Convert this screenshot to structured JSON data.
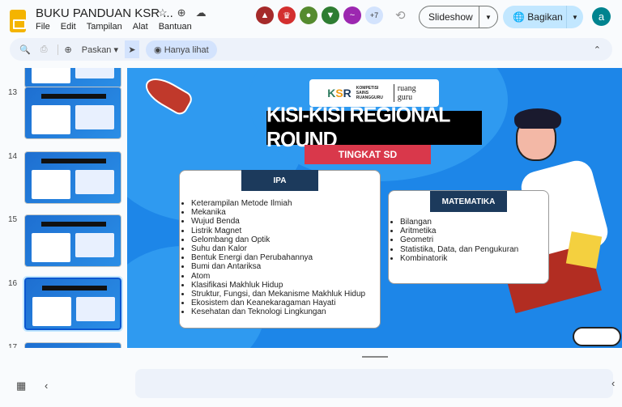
{
  "header": {
    "title": "BUKU PANDUAN KSR ...",
    "menu": [
      "File",
      "Edit",
      "Tampilan",
      "Alat",
      "Bantuan"
    ],
    "more_collaborators": "+7",
    "slideshow": "Slideshow",
    "share": "Bagikan",
    "user_initial": "a"
  },
  "collaborator_colors": [
    "#a52a2a",
    "#d32f2f",
    "#558b2f",
    "#2e7d32",
    "#9c27b0"
  ],
  "toolbar": {
    "zoom": "Paskan",
    "mode": "Hanya lihat"
  },
  "thumbnails": [
    {
      "num": "13"
    },
    {
      "num": "14"
    },
    {
      "num": "15"
    },
    {
      "num": "16",
      "selected": true
    },
    {
      "num": "17"
    }
  ],
  "slide": {
    "logo_text": "KOMPETISI SAINS RUANGGURU",
    "logo_brand": "ruang guru",
    "title": "KISI-KISI REGIONAL ROUND",
    "subtitle": "TINGKAT SD",
    "ipa": {
      "heading": "IPA",
      "items": [
        "Keterampilan Metode Ilmiah",
        "Mekanika",
        "Wujud Benda",
        "Listrik Magnet",
        "Gelombang dan Optik",
        "Suhu dan Kalor",
        "Bentuk Energi dan Perubahannya",
        "Bumi dan Antariksa",
        "Atom",
        "Klasifikasi Makhluk Hidup",
        "Struktur, Fungsi, dan Mekanisme Makhluk Hidup",
        "Ekosistem dan Keanekaragaman Hayati",
        "Kesehatan dan Teknologi Lingkungan"
      ]
    },
    "mat": {
      "heading": "MATEMATIKA",
      "items": [
        "Bilangan",
        "Aritmetika",
        "Geometri",
        "Statistika, Data, dan Pengukuran",
        "Kombinatorik"
      ]
    }
  }
}
